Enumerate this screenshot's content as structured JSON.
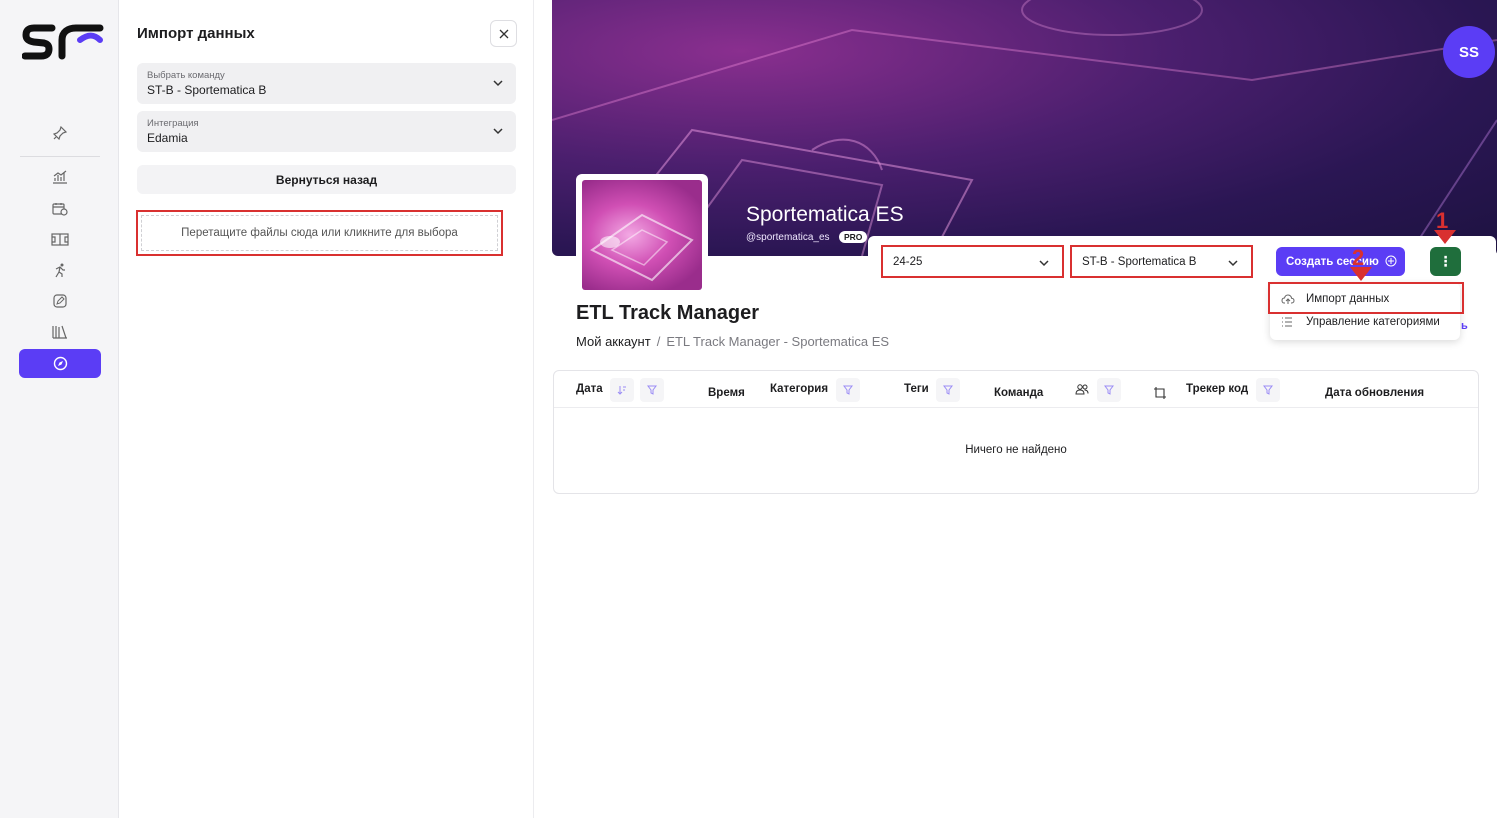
{
  "import_panel": {
    "title": "Импорт данных",
    "team_select": {
      "label": "Выбрать команду",
      "value": "ST-B - Sportematica B"
    },
    "integration_select": {
      "label": "Интеграция",
      "value": "Edamia"
    },
    "back_label": "Вернуться назад",
    "dropzone_text": "Перетащите файлы сюда или кликните для выбора"
  },
  "profile": {
    "avatar_initials": "SS",
    "org_name": "Sportematica ES",
    "handle": "@sportematica_es",
    "badge": "PRO"
  },
  "toolbar": {
    "season_value": "24-25",
    "team_value": "ST-B - Sportematica B",
    "create_label": "Создать сессию",
    "more_glyph": "⋮",
    "annotation_1": "1",
    "annotation_2": "2"
  },
  "menu": {
    "items": [
      {
        "label": "Импорт данных",
        "icon": "cloud-upload-icon"
      },
      {
        "label": "Управление категориями",
        "icon": "list-icon"
      }
    ],
    "stray_text": "ь"
  },
  "page": {
    "title": "ETL Track Manager",
    "breadcrumb": [
      "Мой аккаунт",
      "ETL Track Manager - Sportematica ES"
    ],
    "breadcrumb_sep": "/"
  },
  "table": {
    "columns": [
      "Дата",
      "Время",
      "Категория",
      "Теги",
      "Команда",
      "Трекер код",
      "Дата обновления"
    ],
    "empty_text": "Ничего не найдено"
  },
  "colors": {
    "accent": "#5b3df5",
    "more_button": "#1f6e3c",
    "annotation": "#d93030"
  }
}
